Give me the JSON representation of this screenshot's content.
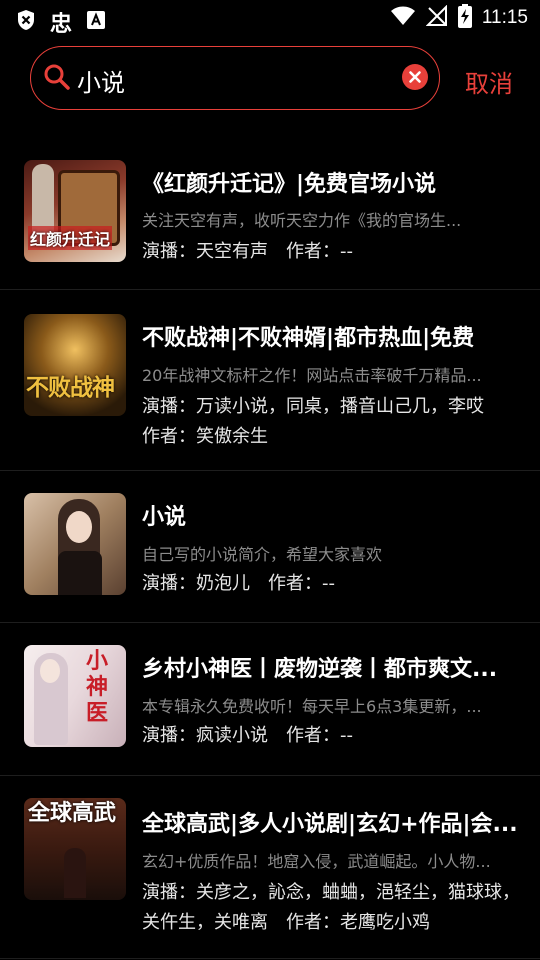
{
  "status_bar": {
    "time": "11:15",
    "app_icon_char": "忠"
  },
  "search": {
    "query": "小说",
    "cancel_label": "取消"
  },
  "results": [
    {
      "title": "《红颜升迁记》|免费官场小说",
      "desc": "关注天空有声，收听天空力作《我的官场生...",
      "broadcast_label": "演播：",
      "broadcast": "天空有声",
      "author_label": "作者：",
      "author": "--",
      "cover_text": "红颜升迁记"
    },
    {
      "title": "不败战神|不败神婿|都市热血|免费",
      "desc": "20年战神文标杆之作！网站点击率破千万精品...",
      "broadcast_label": "演播：",
      "broadcast": "万读小说，同桌，播音山己几，李哎",
      "author_label": "作者：",
      "author": "笑傲余生",
      "cover_text": "不败战神"
    },
    {
      "title": "小说",
      "desc": "自己写的小说简介，希望大家喜欢",
      "broadcast_label": "演播：",
      "broadcast": "奶泡儿",
      "author_label": "作者：",
      "author": "--",
      "cover_text": ""
    },
    {
      "title": "乡村小神医丨废物逆袭丨都市爽文...",
      "desc": "本专辑永久免费收听！每天早上6点3集更新，...",
      "broadcast_label": "演播：",
      "broadcast": "疯读小说",
      "author_label": "作者：",
      "author": "--",
      "cover_text": "小神医"
    },
    {
      "title": "全球高武|多人小说剧|玄幻+作品|会...",
      "desc": "玄幻+优质作品！地窟入侵，武道崛起。小人物...",
      "broadcast_label": "演播：",
      "broadcast": "关彦之，訫念，蛐蛐，浥轻尘，猫球球，关仵生，关唯离",
      "author_label": "作者：",
      "author": "老鹰吃小鸡",
      "cover_text": "全球高武"
    }
  ]
}
